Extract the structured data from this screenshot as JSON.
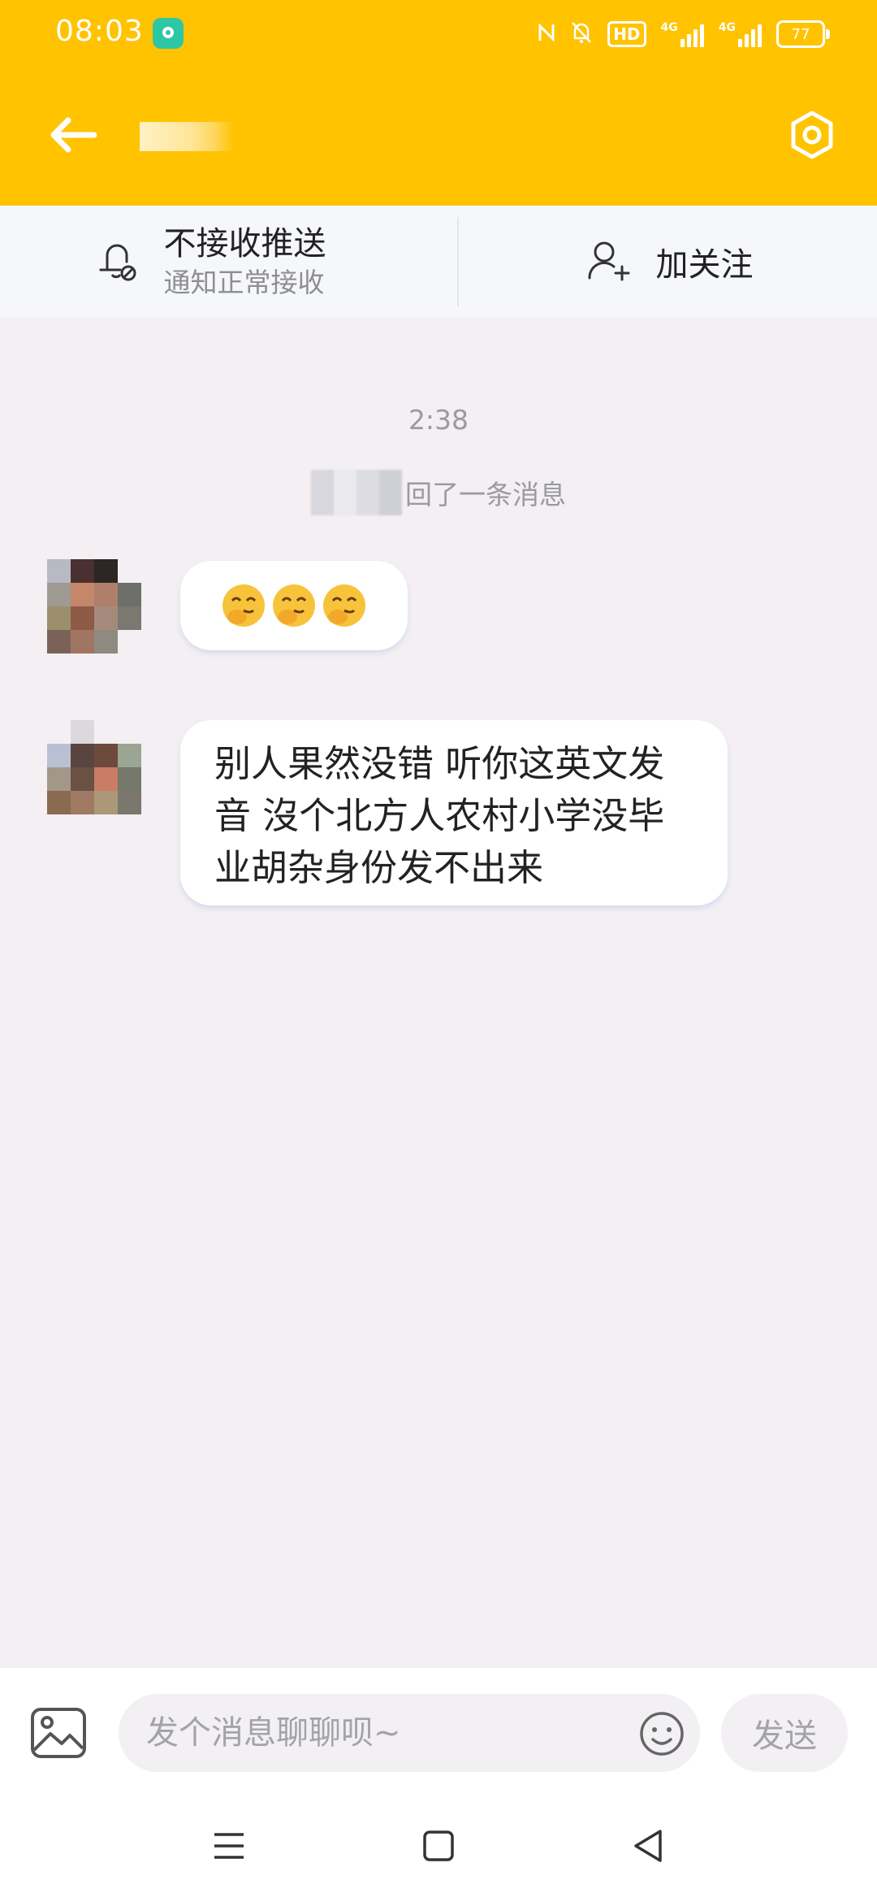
{
  "status_bar": {
    "time": "08:03",
    "hd_label": "HD",
    "network_1": "4G",
    "network_2": "4G",
    "battery": "77",
    "icons": [
      "app-notification-icon",
      "nfc-icon",
      "mute-icon",
      "hd-icon",
      "signal-icon",
      "battery-icon"
    ]
  },
  "header": {
    "title": "",
    "back_icon": "arrow-left-icon",
    "settings_icon": "hexagon-gear-icon",
    "background_color": "#ffc300"
  },
  "action_bar": {
    "push_title": "不接收推送",
    "push_subtitle": "通知正常接收",
    "push_icon": "bell-off-icon",
    "follow_label": "加关注",
    "follow_icon": "user-plus-icon"
  },
  "chat": {
    "timestamp": "2:38",
    "recall_notice": "回了一条消息",
    "messages": [
      {
        "type": "emoji",
        "content": "🤭🤭🤭",
        "emoji_count": 3
      },
      {
        "type": "text",
        "content": "别人果然没错 听你这英文发音 沒个北方人农村小学没毕业胡杂身份发不出来"
      }
    ]
  },
  "input_bar": {
    "placeholder": "发个消息聊聊呗~",
    "value": "",
    "send_label": "发送",
    "image_icon": "image-icon",
    "emoji_icon": "smiley-icon"
  },
  "nav_bar": {
    "icons": [
      "menu-icon",
      "home-square-icon",
      "back-triangle-icon"
    ]
  },
  "colors": {
    "accent": "#ffc300",
    "chat_background": "#f3eff3",
    "bubble": "#ffffff",
    "muted_text": "#9a9aa0"
  }
}
